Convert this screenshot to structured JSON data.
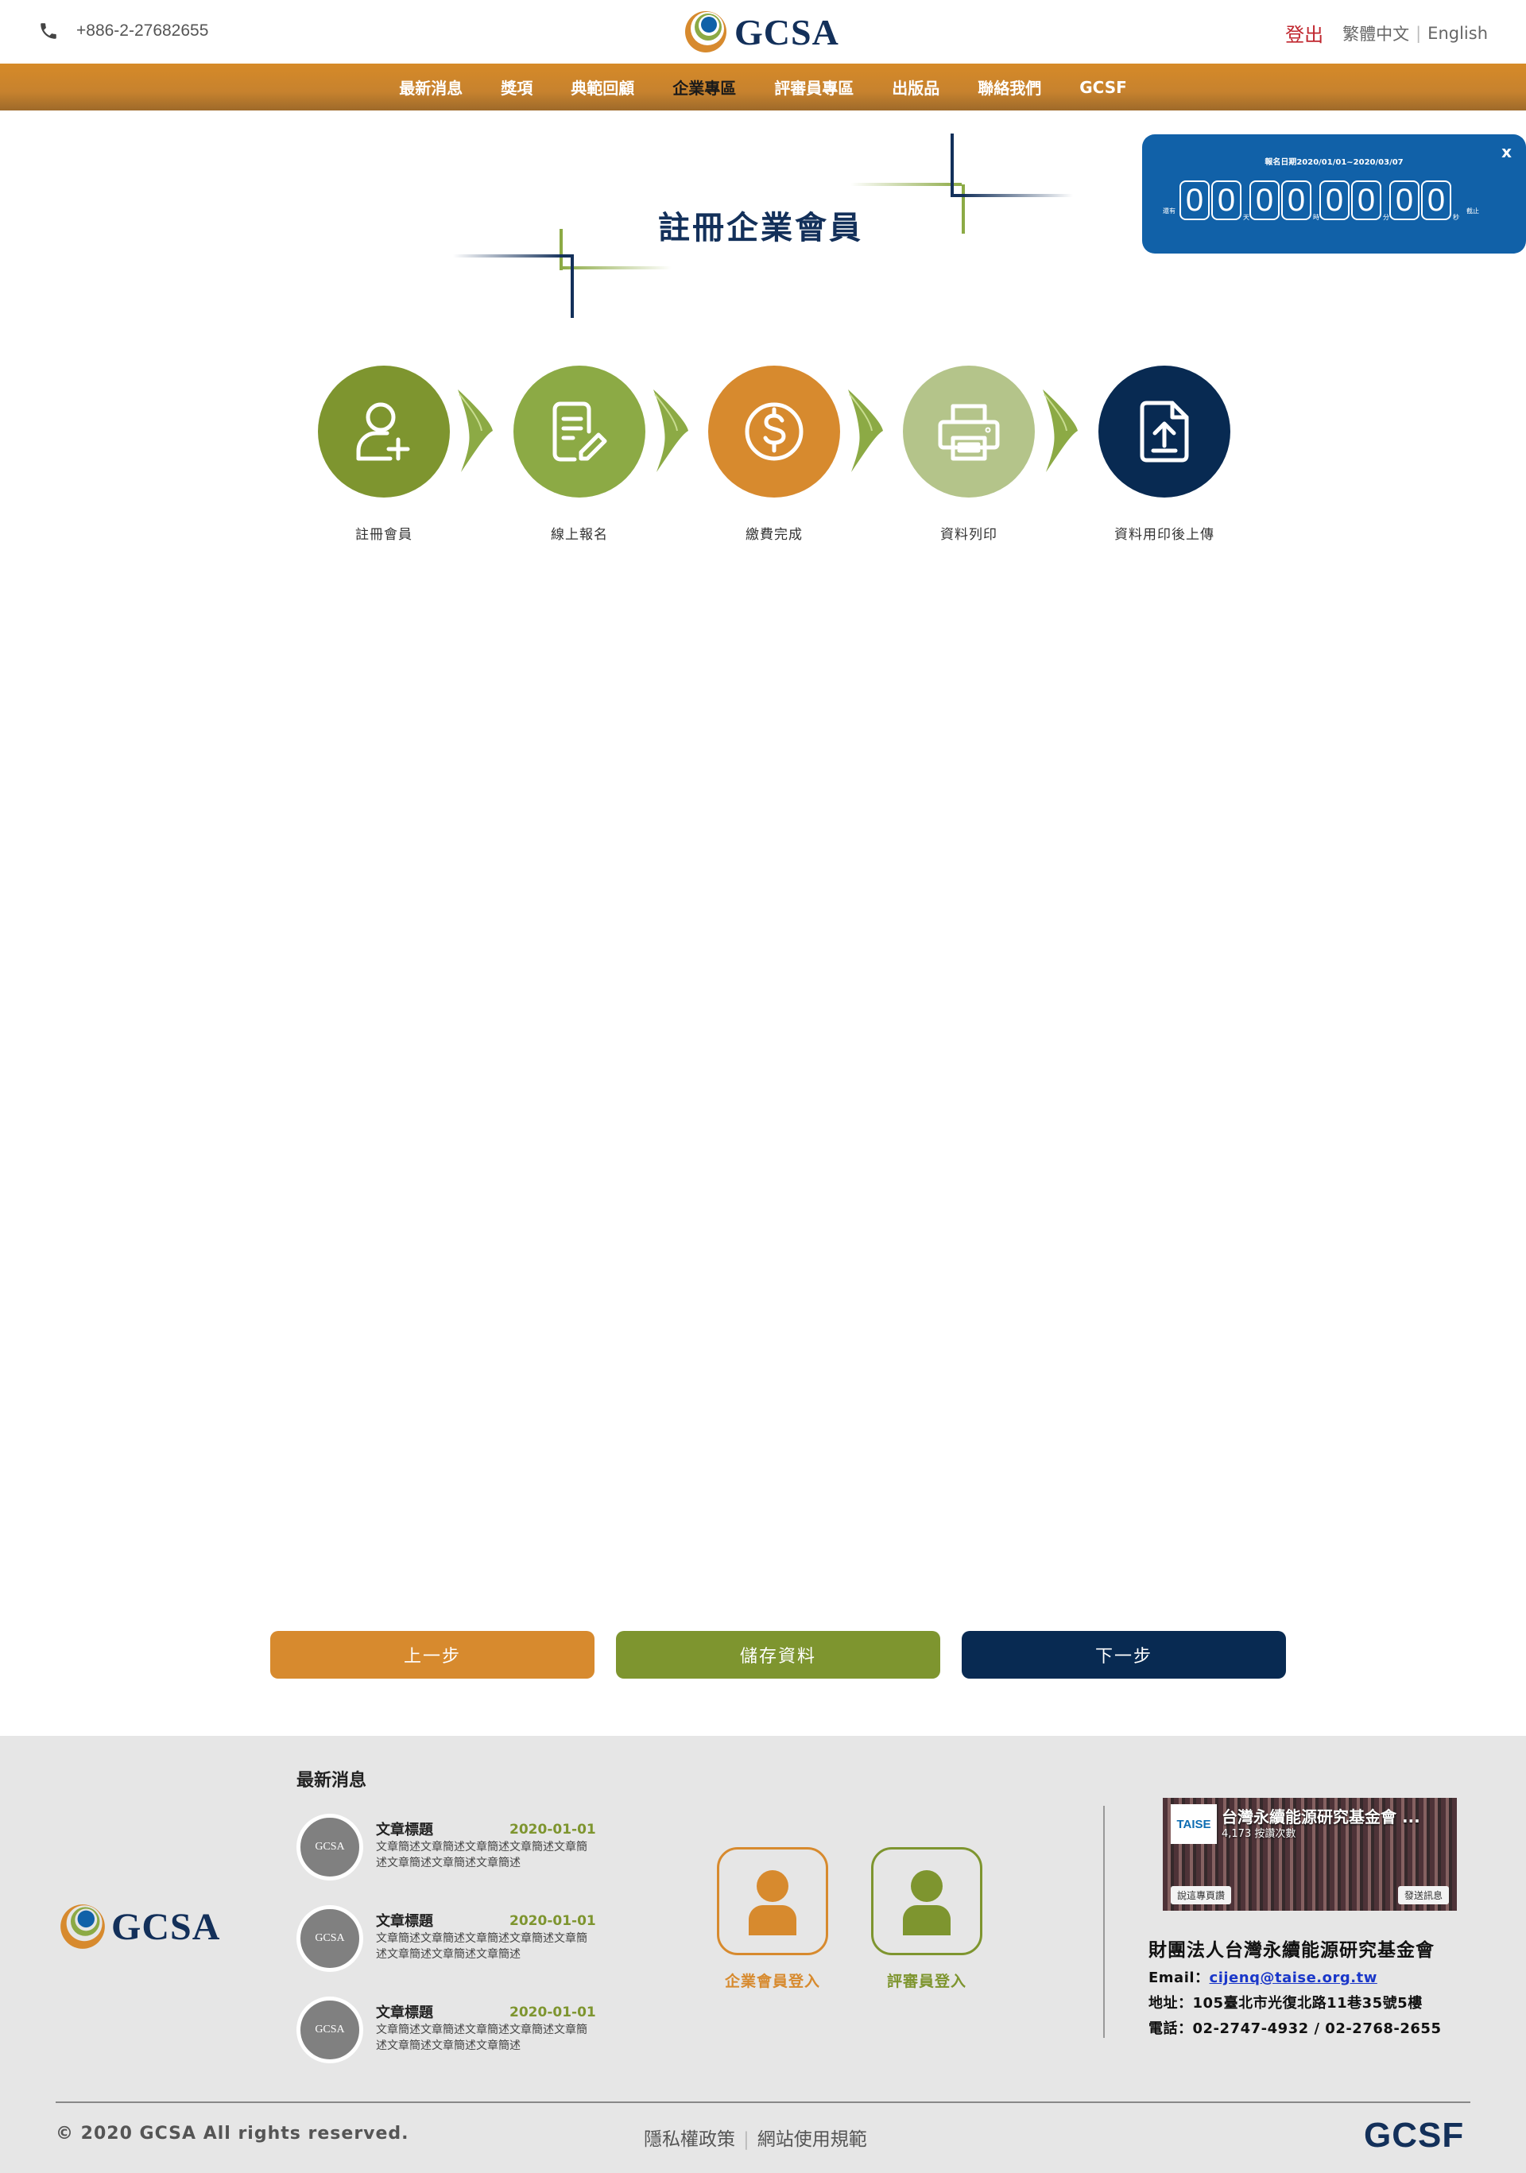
{
  "header": {
    "phone": "+886-2-27682655",
    "logo_text": "GCSA",
    "logout": "登出",
    "lang_zh": "繁體中文",
    "lang_en": "English"
  },
  "nav": {
    "items": [
      {
        "label": "最新消息"
      },
      {
        "label": "獎項"
      },
      {
        "label": "典範回顧"
      },
      {
        "label": "企業專區"
      },
      {
        "label": "評審員專區"
      },
      {
        "label": "出版品"
      },
      {
        "label": "聯絡我們"
      },
      {
        "label": "GCSF"
      }
    ],
    "active_index": 3
  },
  "page_title": "註冊企業會員",
  "countdown": {
    "close": "x",
    "range": "報名日期2020/01/01~2020/03/07",
    "left_tag": "還有",
    "right_tag": "截止",
    "groups": [
      {
        "digits": [
          "0",
          "0"
        ],
        "unit": "天"
      },
      {
        "digits": [
          "0",
          "0"
        ],
        "unit": "時"
      },
      {
        "digits": [
          "0",
          "0"
        ],
        "unit": "分"
      },
      {
        "digits": [
          "0",
          "0"
        ],
        "unit": "秒"
      }
    ]
  },
  "steps": [
    {
      "label": "註冊會員",
      "icon": "user-add-icon",
      "color": "#7e952f"
    },
    {
      "label": "線上報名",
      "icon": "edit-document-icon",
      "color": "#8caa45"
    },
    {
      "label": "繳費完成",
      "icon": "dollar-icon",
      "color": "#d78a2e"
    },
    {
      "label": "資料列印",
      "icon": "printer-icon",
      "color": "#b4c48a"
    },
    {
      "label": "資料用印後上傳",
      "icon": "upload-file-icon",
      "color": "#082a52"
    }
  ],
  "buttons": {
    "prev": "上一步",
    "save": "儲存資料",
    "next": "下一步"
  },
  "footer": {
    "logo_text": "GCSA",
    "news_heading": "最新消息",
    "news": [
      {
        "thumb": "GCSA",
        "title": "文章標題",
        "date": "2020-01-01",
        "desc": "文章簡述文章簡述文章簡述文章簡述文章簡述文章簡述文章簡述文章簡述"
      },
      {
        "thumb": "GCSA",
        "title": "文章標題",
        "date": "2020-01-01",
        "desc": "文章簡述文章簡述文章簡述文章簡述文章簡述文章簡述文章簡述文章簡述"
      },
      {
        "thumb": "GCSA",
        "title": "文章標題",
        "date": "2020-01-01",
        "desc": "文章簡述文章簡述文章簡述文章簡述文章簡述文章簡述文章簡述文章簡述"
      }
    ],
    "login_enterprise": "企業會員登入",
    "login_judge": "評審員登入",
    "fb": {
      "logo": "TAISE",
      "name": "台灣永續能源研究基金會 ...",
      "likes": "4,173 按讚次數",
      "like_btn": "說這專頁讚",
      "msg_btn": "發送訊息"
    },
    "org": {
      "name": "財團法人台灣永續能源研究基金會",
      "email_label": "Email：",
      "email": "cijenq@taise.org.tw",
      "address": "地址：105臺北市光復北路11巷35號5樓",
      "tel": "電話：02-2747-4932 / 02-2768-2655"
    },
    "copyright": "© 2020 GCSA All rights reserved.",
    "privacy": "隱私權政策",
    "terms": "網站使用規範",
    "gcsf": "GCSF"
  },
  "colors": {
    "nav": "#c7822e",
    "navy": "#13305a",
    "orange": "#d78a2e",
    "green": "#7e952f",
    "countdown": "#1161a8"
  }
}
